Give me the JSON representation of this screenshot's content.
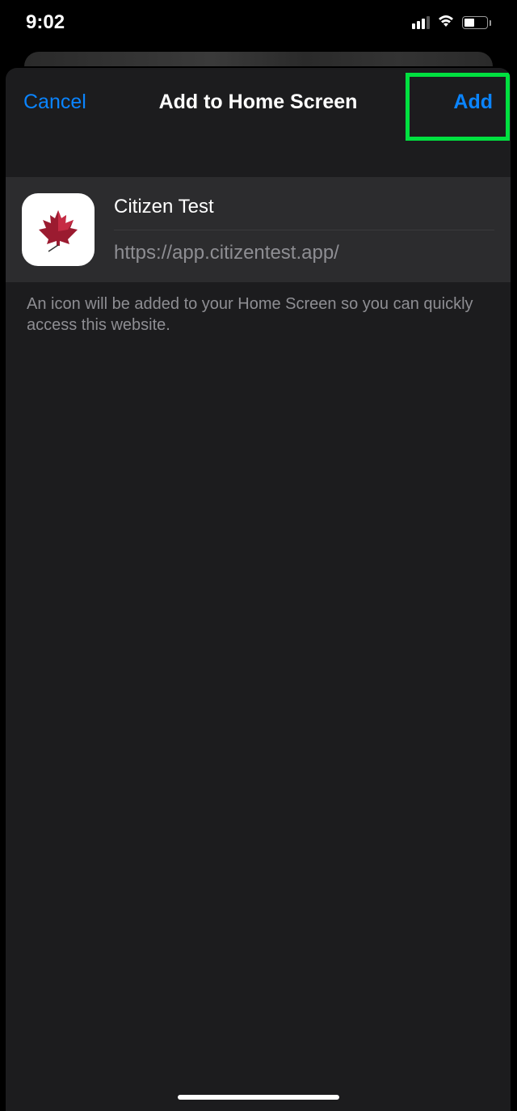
{
  "statusBar": {
    "time": "9:02"
  },
  "sheet": {
    "cancelLabel": "Cancel",
    "title": "Add to Home Screen",
    "addLabel": "Add",
    "appName": "Citizen Test",
    "appUrl": "https://app.citizentest.app/",
    "helpText": "An icon will be added to your Home Screen so you can quickly access this website."
  }
}
